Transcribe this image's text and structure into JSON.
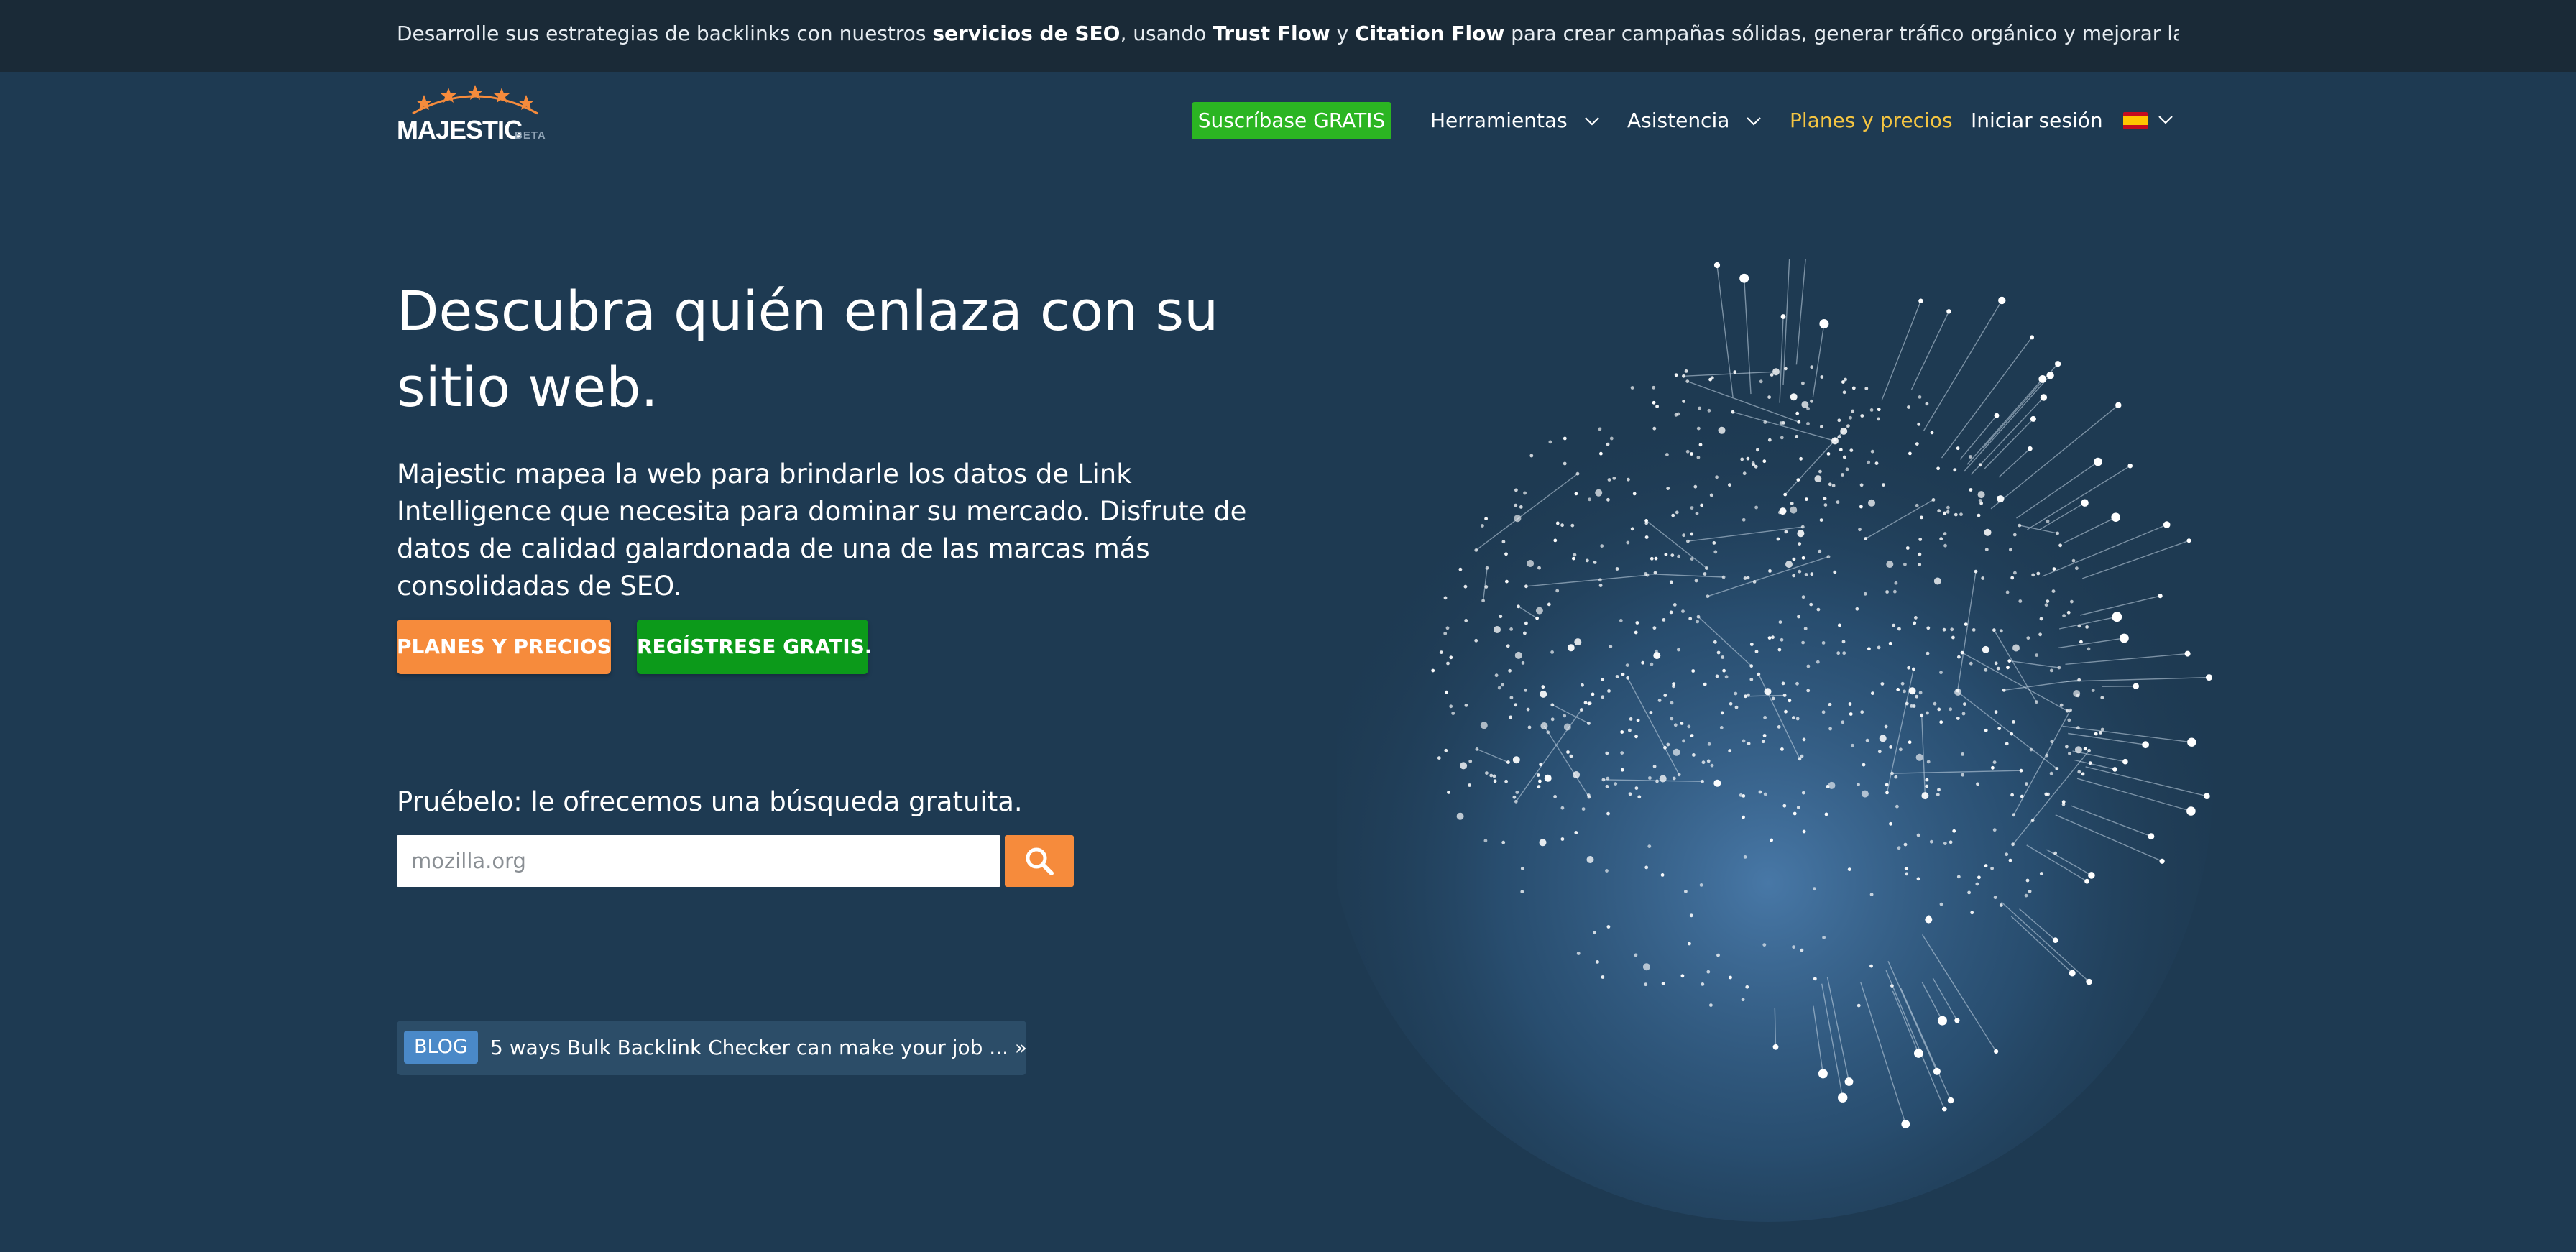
{
  "banner": {
    "part1": "Desarrolle sus estrategias de backlinks con nuestros ",
    "bold1": "servicios de SEO",
    "part2": ", usando ",
    "bold2": "Trust Flow",
    "part3": " y ",
    "bold3": "Citation Flow",
    "part4": " para crear campañas sólidas, generar tráfico orgánico y mejorar las"
  },
  "logo": {
    "word": "MAJESTIC",
    "beta": "BETA"
  },
  "nav": {
    "subscribe": "Suscríbase GRATIS",
    "tools": "Herramientas",
    "help": "Asistencia",
    "plans": "Planes y precios",
    "login": "Iniciar sesión",
    "language_icon": "spain-flag-icon"
  },
  "hero": {
    "title": "Descubra quién enlaza con su sitio web.",
    "description": "Majestic mapea la web para brindarle los datos de Link Intelligence que necesita para dominar su mercado. Disfrute de datos de calidad galardonada de una de las marcas más consolidadas de SEO.",
    "cta_plans": "PLANES Y PRECIOS",
    "cta_register": "REGÍSTRESE GRATIS."
  },
  "search": {
    "label": "Pruébelo: le ofrecemos una búsqueda gratuita.",
    "placeholder": "mozilla.org",
    "button_icon": "search-icon"
  },
  "blog": {
    "badge": "BLOG",
    "headline": "5 ways Bulk Backlink Checker can make your job ... »"
  },
  "colors": {
    "background": "#1e3a52",
    "banner": "#1a2a37",
    "subscribe_green": "#2bb522",
    "register_green": "#0c9a1a",
    "orange": "#f68b3c",
    "plans_link": "#f5c542",
    "blog_badge": "#4a89c8"
  }
}
